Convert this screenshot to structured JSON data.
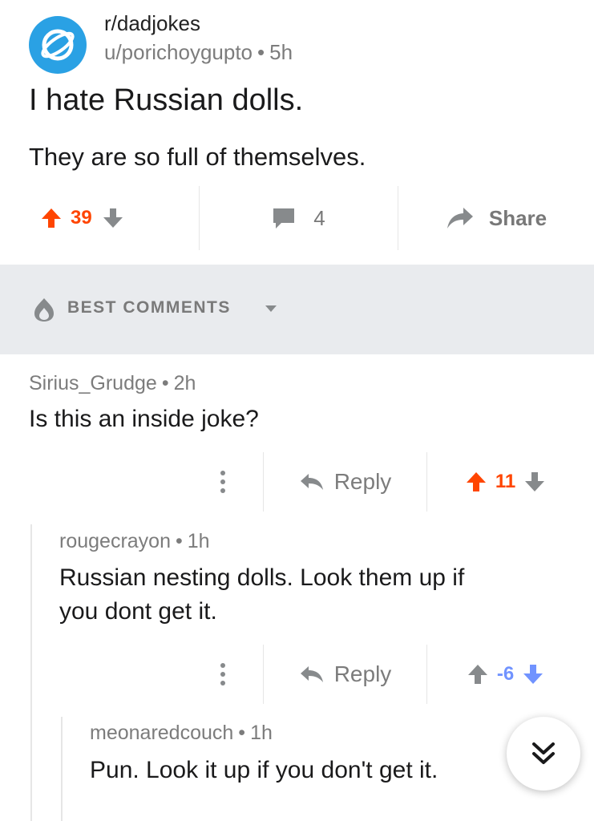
{
  "post": {
    "subreddit": "r/dadjokes",
    "author": "u/porichoygupto",
    "age": "5h",
    "title": "I hate Russian dolls.",
    "body": "They are so full of themselves.",
    "score": "39",
    "comment_count": "4",
    "share_label": "Share"
  },
  "sort": {
    "label": "BEST COMMENTS"
  },
  "comments": [
    {
      "author": "Sirius_Grudge",
      "age": "2h",
      "body": "Is this an inside joke?",
      "reply_label": "Reply",
      "score": "11"
    },
    {
      "author": "rougecrayon",
      "age": "1h",
      "body_line1": "Russian nesting dolls. Look them up if",
      "body_line2": "you dont get it.",
      "reply_label": "Reply",
      "score": "-6"
    },
    {
      "author": "meonaredcouch",
      "age": "1h",
      "body": "Pun. Look it up if you don't get it."
    }
  ],
  "colors": {
    "upvote": "#ff4500",
    "downvote": "#7193ff",
    "neutral": "#878a8c",
    "avatar": "#2aa1e4"
  },
  "icons": [
    "reddit-planet-icon",
    "upvote-icon",
    "downvote-icon",
    "comment-icon",
    "share-icon",
    "flame-icon",
    "caret-down-icon",
    "more-vertical-icon",
    "reply-icon",
    "double-chevron-down-icon"
  ]
}
